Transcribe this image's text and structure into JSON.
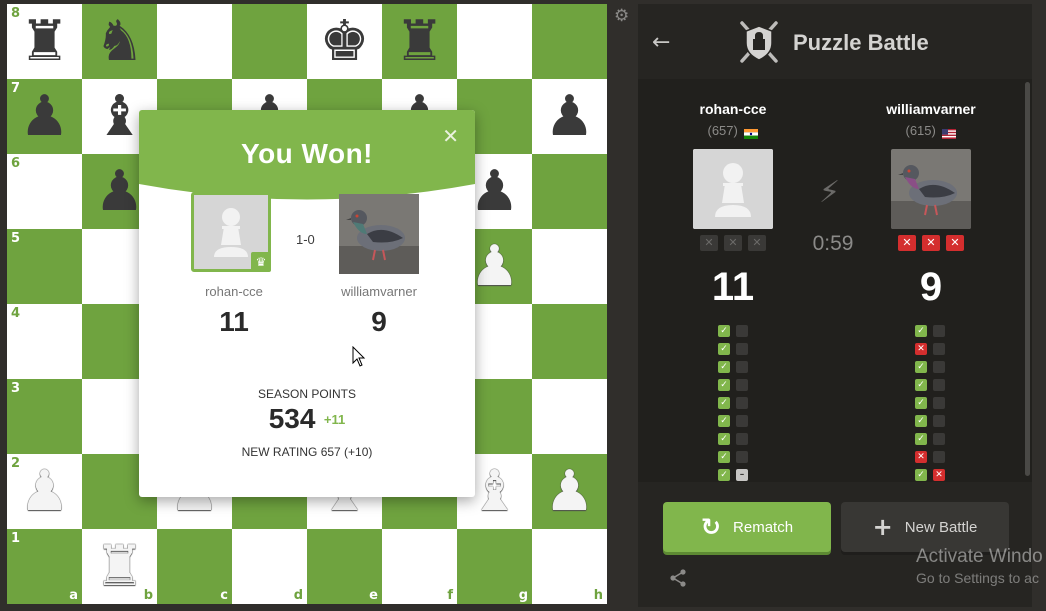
{
  "board": {
    "rank_labels": [
      "8",
      "7",
      "6",
      "5",
      "4",
      "3",
      "2",
      "1"
    ],
    "file_labels": [
      "a",
      "b",
      "c",
      "d",
      "e",
      "f",
      "g",
      "h"
    ],
    "pieces": [
      "br",
      "bn",
      "",
      "",
      "bk",
      "br",
      "",
      "",
      "bp",
      "bb",
      "",
      "bp",
      "",
      "bp",
      "",
      "bp",
      "",
      "bp",
      "",
      "",
      "",
      "",
      "bp",
      "",
      "",
      "",
      "",
      "",
      "",
      "",
      "wp",
      "",
      "",
      "",
      "",
      "",
      "",
      "",
      "",
      "",
      "",
      "",
      "",
      "",
      "",
      "",
      "",
      "",
      "wp",
      "",
      "wp",
      "",
      "wb",
      "",
      "wb",
      "wp",
      "",
      "wr",
      "",
      "",
      "",
      "",
      "",
      ""
    ],
    "colors": {
      "light": "#ffffff",
      "dark": "#6fa33f"
    },
    "settings_icon": "gear-icon"
  },
  "result_modal": {
    "title": "You Won!",
    "close_icon": "close-icon",
    "score": "1-0",
    "player": {
      "name": "rohan-cce",
      "score": "11",
      "badge_icon": "crown-icon"
    },
    "opponent": {
      "name": "williamvarner",
      "score": "9"
    },
    "season_points_label": "SEASON POINTS",
    "season_points": "534",
    "season_delta": "+11",
    "new_rating": "NEW RATING 657 (+10)",
    "accent_color": "#81b64c"
  },
  "panel": {
    "back_icon": "back-arrow-icon",
    "title": "Puzzle Battle",
    "player": {
      "name": "rohan-cce",
      "rating": "(657)",
      "flag": "india",
      "score": "11",
      "strikes": [
        false,
        false,
        false
      ],
      "results": [
        [
          "ok",
          "empty"
        ],
        [
          "ok",
          "empty"
        ],
        [
          "ok",
          "empty"
        ],
        [
          "ok",
          "empty"
        ],
        [
          "ok",
          "empty"
        ],
        [
          "ok",
          "empty"
        ],
        [
          "ok",
          "empty"
        ],
        [
          "ok",
          "empty"
        ],
        [
          "ok",
          "skip"
        ],
        [
          "ok",
          "ok"
        ]
      ]
    },
    "opponent": {
      "name": "williamvarner",
      "rating": "(615)",
      "flag": "usa",
      "score": "9",
      "strikes": [
        true,
        true,
        true
      ],
      "results": [
        [
          "ok",
          "empty"
        ],
        [
          "fail",
          "empty"
        ],
        [
          "ok",
          "empty"
        ],
        [
          "ok",
          "empty"
        ],
        [
          "ok",
          "empty"
        ],
        [
          "ok",
          "empty"
        ],
        [
          "ok",
          "empty"
        ],
        [
          "fail",
          "empty"
        ],
        [
          "ok",
          "fail"
        ],
        [
          "ok",
          "ok"
        ]
      ]
    },
    "timer": "0:59",
    "bolt_icon": "lightning-icon",
    "rematch_label": "Rematch",
    "new_battle_label": "New Battle",
    "share_icon": "share-icon"
  },
  "os_watermark": {
    "line1": "Activate Windo",
    "line2": "Go to Settings to ac"
  }
}
